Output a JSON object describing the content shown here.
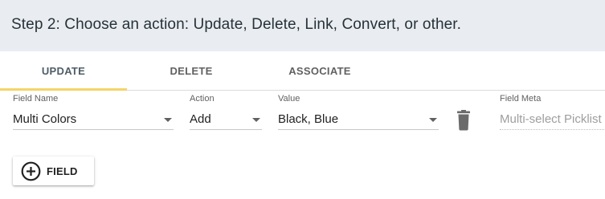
{
  "step": {
    "title": "Step 2: Choose an action: Update, Delete, Link, Convert, or other."
  },
  "tabs": [
    {
      "label": "UPDATE",
      "active": true
    },
    {
      "label": "DELETE",
      "active": false
    },
    {
      "label": "ASSOCIATE",
      "active": false
    }
  ],
  "fields": {
    "field_name": {
      "label": "Field Name",
      "value": "Multi Colors"
    },
    "action": {
      "label": "Action",
      "value": "Add"
    },
    "value": {
      "label": "Value",
      "value": "Black, Blue"
    },
    "field_meta": {
      "label": "Field Meta",
      "value": "Multi-select Picklist"
    }
  },
  "buttons": {
    "add_field_label": "FIELD"
  },
  "icons": {
    "delete": "trash-icon",
    "add": "plus-circle-icon"
  },
  "colors": {
    "header_bg": "#e9edf1",
    "tab_indicator": "#f4d468"
  }
}
